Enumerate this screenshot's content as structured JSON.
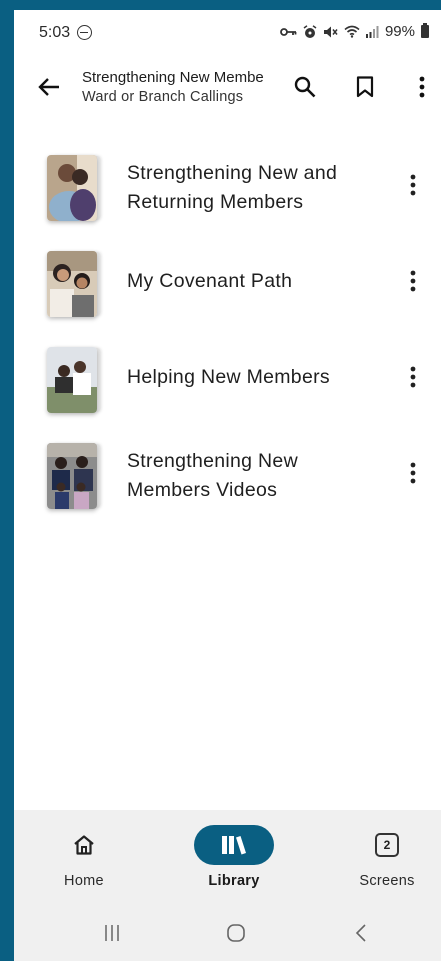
{
  "status_bar": {
    "time": "5:03",
    "battery": "99%",
    "icons": [
      "vpn-key-icon",
      "alarm-icon",
      "mute-icon",
      "wifi-icon",
      "signal-icon",
      "battery-icon"
    ]
  },
  "app_bar": {
    "title": "Strengthening New Membe",
    "subtitle": "Ward or Branch Callings"
  },
  "items": [
    {
      "label": "Strengthening New and Returning Members",
      "thumb_colors": [
        "#b9a58c",
        "#6d87a6",
        "#efe7dc"
      ]
    },
    {
      "label": "My Covenant Path",
      "thumb_colors": [
        "#d8cbb8",
        "#3b2e2a",
        "#f2ede6"
      ]
    },
    {
      "label": "Helping New Members",
      "thumb_colors": [
        "#7f8f6a",
        "#3a3a3a",
        "#dfe3e8"
      ]
    },
    {
      "label": "Strengthening New Members Videos",
      "thumb_colors": [
        "#8c8c8c",
        "#2e3550",
        "#c9a7c4"
      ]
    }
  ],
  "bottom_nav": {
    "home": "Home",
    "library": "Library",
    "screens": "Screens",
    "screens_count": "2"
  },
  "colors": {
    "accent": "#0a5f82",
    "nav_bg": "#f0f0f0"
  }
}
